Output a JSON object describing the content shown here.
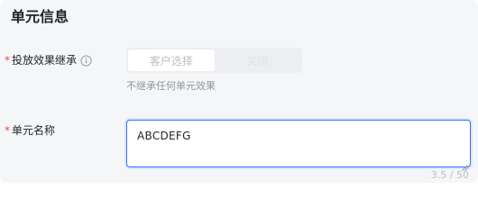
{
  "section": {
    "title": "单元信息"
  },
  "fields": {
    "inherit": {
      "required_mark": "*",
      "label": "投放效果继承",
      "options": [
        "客户选择",
        "关闭"
      ],
      "selected": "客户选择",
      "help": "不继承任何单元效果"
    },
    "unit_name": {
      "required_mark": "*",
      "label": "单元名称",
      "value": "ABCDEFG",
      "counter": "3.5 / 50"
    }
  },
  "colors": {
    "required": "#f54a45",
    "accent": "#3370ff",
    "muted": "#8f959e",
    "disabled_text": "#bbbfc4"
  },
  "icons": {
    "inherit_info": "info-circle-icon",
    "textarea_resize": "resize-handle-icon"
  }
}
